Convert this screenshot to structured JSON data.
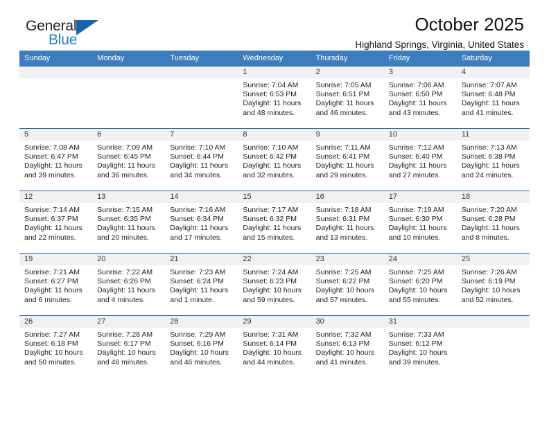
{
  "brand": {
    "name_part1": "General",
    "name_part2": "Blue",
    "triangle_icon": "blue-triangle-icon"
  },
  "header": {
    "title": "October 2025",
    "location": "Highland Springs, Virginia, United States"
  },
  "colors": {
    "header_blue": "#3b7dbf",
    "row_border_blue": "#2f6ca8",
    "daynum_band": "#f1f1f1",
    "brand_blue": "#1f7fc4"
  },
  "weekdays": [
    "Sunday",
    "Monday",
    "Tuesday",
    "Wednesday",
    "Thursday",
    "Friday",
    "Saturday"
  ],
  "weeks": [
    [
      {
        "day": "",
        "empty": true
      },
      {
        "day": "",
        "empty": true
      },
      {
        "day": "",
        "empty": true
      },
      {
        "day": "1",
        "sunrise": "Sunrise: 7:04 AM",
        "sunset": "Sunset: 6:53 PM",
        "daylight1": "Daylight: 11 hours",
        "daylight2": "and 48 minutes."
      },
      {
        "day": "2",
        "sunrise": "Sunrise: 7:05 AM",
        "sunset": "Sunset: 6:51 PM",
        "daylight1": "Daylight: 11 hours",
        "daylight2": "and 46 minutes."
      },
      {
        "day": "3",
        "sunrise": "Sunrise: 7:06 AM",
        "sunset": "Sunset: 6:50 PM",
        "daylight1": "Daylight: 11 hours",
        "daylight2": "and 43 minutes."
      },
      {
        "day": "4",
        "sunrise": "Sunrise: 7:07 AM",
        "sunset": "Sunset: 6:48 PM",
        "daylight1": "Daylight: 11 hours",
        "daylight2": "and 41 minutes."
      }
    ],
    [
      {
        "day": "5",
        "sunrise": "Sunrise: 7:08 AM",
        "sunset": "Sunset: 6:47 PM",
        "daylight1": "Daylight: 11 hours",
        "daylight2": "and 39 minutes."
      },
      {
        "day": "6",
        "sunrise": "Sunrise: 7:09 AM",
        "sunset": "Sunset: 6:45 PM",
        "daylight1": "Daylight: 11 hours",
        "daylight2": "and 36 minutes."
      },
      {
        "day": "7",
        "sunrise": "Sunrise: 7:10 AM",
        "sunset": "Sunset: 6:44 PM",
        "daylight1": "Daylight: 11 hours",
        "daylight2": "and 34 minutes."
      },
      {
        "day": "8",
        "sunrise": "Sunrise: 7:10 AM",
        "sunset": "Sunset: 6:42 PM",
        "daylight1": "Daylight: 11 hours",
        "daylight2": "and 32 minutes."
      },
      {
        "day": "9",
        "sunrise": "Sunrise: 7:11 AM",
        "sunset": "Sunset: 6:41 PM",
        "daylight1": "Daylight: 11 hours",
        "daylight2": "and 29 minutes."
      },
      {
        "day": "10",
        "sunrise": "Sunrise: 7:12 AM",
        "sunset": "Sunset: 6:40 PM",
        "daylight1": "Daylight: 11 hours",
        "daylight2": "and 27 minutes."
      },
      {
        "day": "11",
        "sunrise": "Sunrise: 7:13 AM",
        "sunset": "Sunset: 6:38 PM",
        "daylight1": "Daylight: 11 hours",
        "daylight2": "and 24 minutes."
      }
    ],
    [
      {
        "day": "12",
        "sunrise": "Sunrise: 7:14 AM",
        "sunset": "Sunset: 6:37 PM",
        "daylight1": "Daylight: 11 hours",
        "daylight2": "and 22 minutes."
      },
      {
        "day": "13",
        "sunrise": "Sunrise: 7:15 AM",
        "sunset": "Sunset: 6:35 PM",
        "daylight1": "Daylight: 11 hours",
        "daylight2": "and 20 minutes."
      },
      {
        "day": "14",
        "sunrise": "Sunrise: 7:16 AM",
        "sunset": "Sunset: 6:34 PM",
        "daylight1": "Daylight: 11 hours",
        "daylight2": "and 17 minutes."
      },
      {
        "day": "15",
        "sunrise": "Sunrise: 7:17 AM",
        "sunset": "Sunset: 6:32 PM",
        "daylight1": "Daylight: 11 hours",
        "daylight2": "and 15 minutes."
      },
      {
        "day": "16",
        "sunrise": "Sunrise: 7:18 AM",
        "sunset": "Sunset: 6:31 PM",
        "daylight1": "Daylight: 11 hours",
        "daylight2": "and 13 minutes."
      },
      {
        "day": "17",
        "sunrise": "Sunrise: 7:19 AM",
        "sunset": "Sunset: 6:30 PM",
        "daylight1": "Daylight: 11 hours",
        "daylight2": "and 10 minutes."
      },
      {
        "day": "18",
        "sunrise": "Sunrise: 7:20 AM",
        "sunset": "Sunset: 6:28 PM",
        "daylight1": "Daylight: 11 hours",
        "daylight2": "and 8 minutes."
      }
    ],
    [
      {
        "day": "19",
        "sunrise": "Sunrise: 7:21 AM",
        "sunset": "Sunset: 6:27 PM",
        "daylight1": "Daylight: 11 hours",
        "daylight2": "and 6 minutes."
      },
      {
        "day": "20",
        "sunrise": "Sunrise: 7:22 AM",
        "sunset": "Sunset: 6:26 PM",
        "daylight1": "Daylight: 11 hours",
        "daylight2": "and 4 minutes."
      },
      {
        "day": "21",
        "sunrise": "Sunrise: 7:23 AM",
        "sunset": "Sunset: 6:24 PM",
        "daylight1": "Daylight: 11 hours",
        "daylight2": "and 1 minute."
      },
      {
        "day": "22",
        "sunrise": "Sunrise: 7:24 AM",
        "sunset": "Sunset: 6:23 PM",
        "daylight1": "Daylight: 10 hours",
        "daylight2": "and 59 minutes."
      },
      {
        "day": "23",
        "sunrise": "Sunrise: 7:25 AM",
        "sunset": "Sunset: 6:22 PM",
        "daylight1": "Daylight: 10 hours",
        "daylight2": "and 57 minutes."
      },
      {
        "day": "24",
        "sunrise": "Sunrise: 7:25 AM",
        "sunset": "Sunset: 6:20 PM",
        "daylight1": "Daylight: 10 hours",
        "daylight2": "and 55 minutes."
      },
      {
        "day": "25",
        "sunrise": "Sunrise: 7:26 AM",
        "sunset": "Sunset: 6:19 PM",
        "daylight1": "Daylight: 10 hours",
        "daylight2": "and 52 minutes."
      }
    ],
    [
      {
        "day": "26",
        "sunrise": "Sunrise: 7:27 AM",
        "sunset": "Sunset: 6:18 PM",
        "daylight1": "Daylight: 10 hours",
        "daylight2": "and 50 minutes."
      },
      {
        "day": "27",
        "sunrise": "Sunrise: 7:28 AM",
        "sunset": "Sunset: 6:17 PM",
        "daylight1": "Daylight: 10 hours",
        "daylight2": "and 48 minutes."
      },
      {
        "day": "28",
        "sunrise": "Sunrise: 7:29 AM",
        "sunset": "Sunset: 6:16 PM",
        "daylight1": "Daylight: 10 hours",
        "daylight2": "and 46 minutes."
      },
      {
        "day": "29",
        "sunrise": "Sunrise: 7:31 AM",
        "sunset": "Sunset: 6:14 PM",
        "daylight1": "Daylight: 10 hours",
        "daylight2": "and 44 minutes."
      },
      {
        "day": "30",
        "sunrise": "Sunrise: 7:32 AM",
        "sunset": "Sunset: 6:13 PM",
        "daylight1": "Daylight: 10 hours",
        "daylight2": "and 41 minutes."
      },
      {
        "day": "31",
        "sunrise": "Sunrise: 7:33 AM",
        "sunset": "Sunset: 6:12 PM",
        "daylight1": "Daylight: 10 hours",
        "daylight2": "and 39 minutes."
      },
      {
        "day": "",
        "empty": true
      }
    ]
  ]
}
